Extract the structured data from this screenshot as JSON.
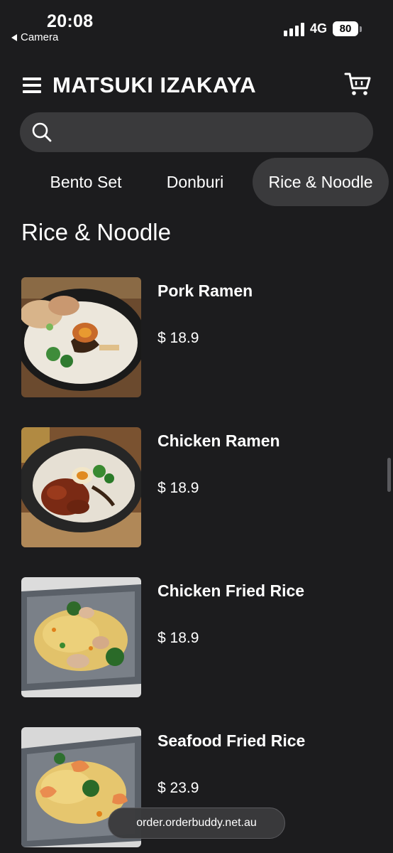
{
  "status_bar": {
    "time": "20:08",
    "back_app": "Camera",
    "network": "4G",
    "battery": "80"
  },
  "header": {
    "title": "MATSUKI IZAKAYA",
    "menu_icon": "hamburger-menu-icon",
    "cart_icon": "shopping-cart-icon"
  },
  "search": {
    "placeholder": "",
    "value": "",
    "icon": "search-icon"
  },
  "tabs": [
    {
      "label": "Bento Set",
      "active": false
    },
    {
      "label": "Donburi",
      "active": false
    },
    {
      "label": "Rice & Noodle",
      "active": true
    }
  ],
  "section": {
    "title": "Rice & Noodle"
  },
  "items": [
    {
      "name": "Pork Ramen",
      "price": "$ 18.9"
    },
    {
      "name": "Chicken Ramen",
      "price": "$ 18.9"
    },
    {
      "name": "Chicken Fried Rice",
      "price": "$ 18.9"
    },
    {
      "name": "Seafood Fried Rice",
      "price": "$ 23.9"
    }
  ],
  "url_bar": {
    "url": "order.orderbuddy.net.au"
  },
  "colors": {
    "background": "#1c1c1e",
    "surface": "#3a3a3c",
    "text": "#ffffff"
  }
}
